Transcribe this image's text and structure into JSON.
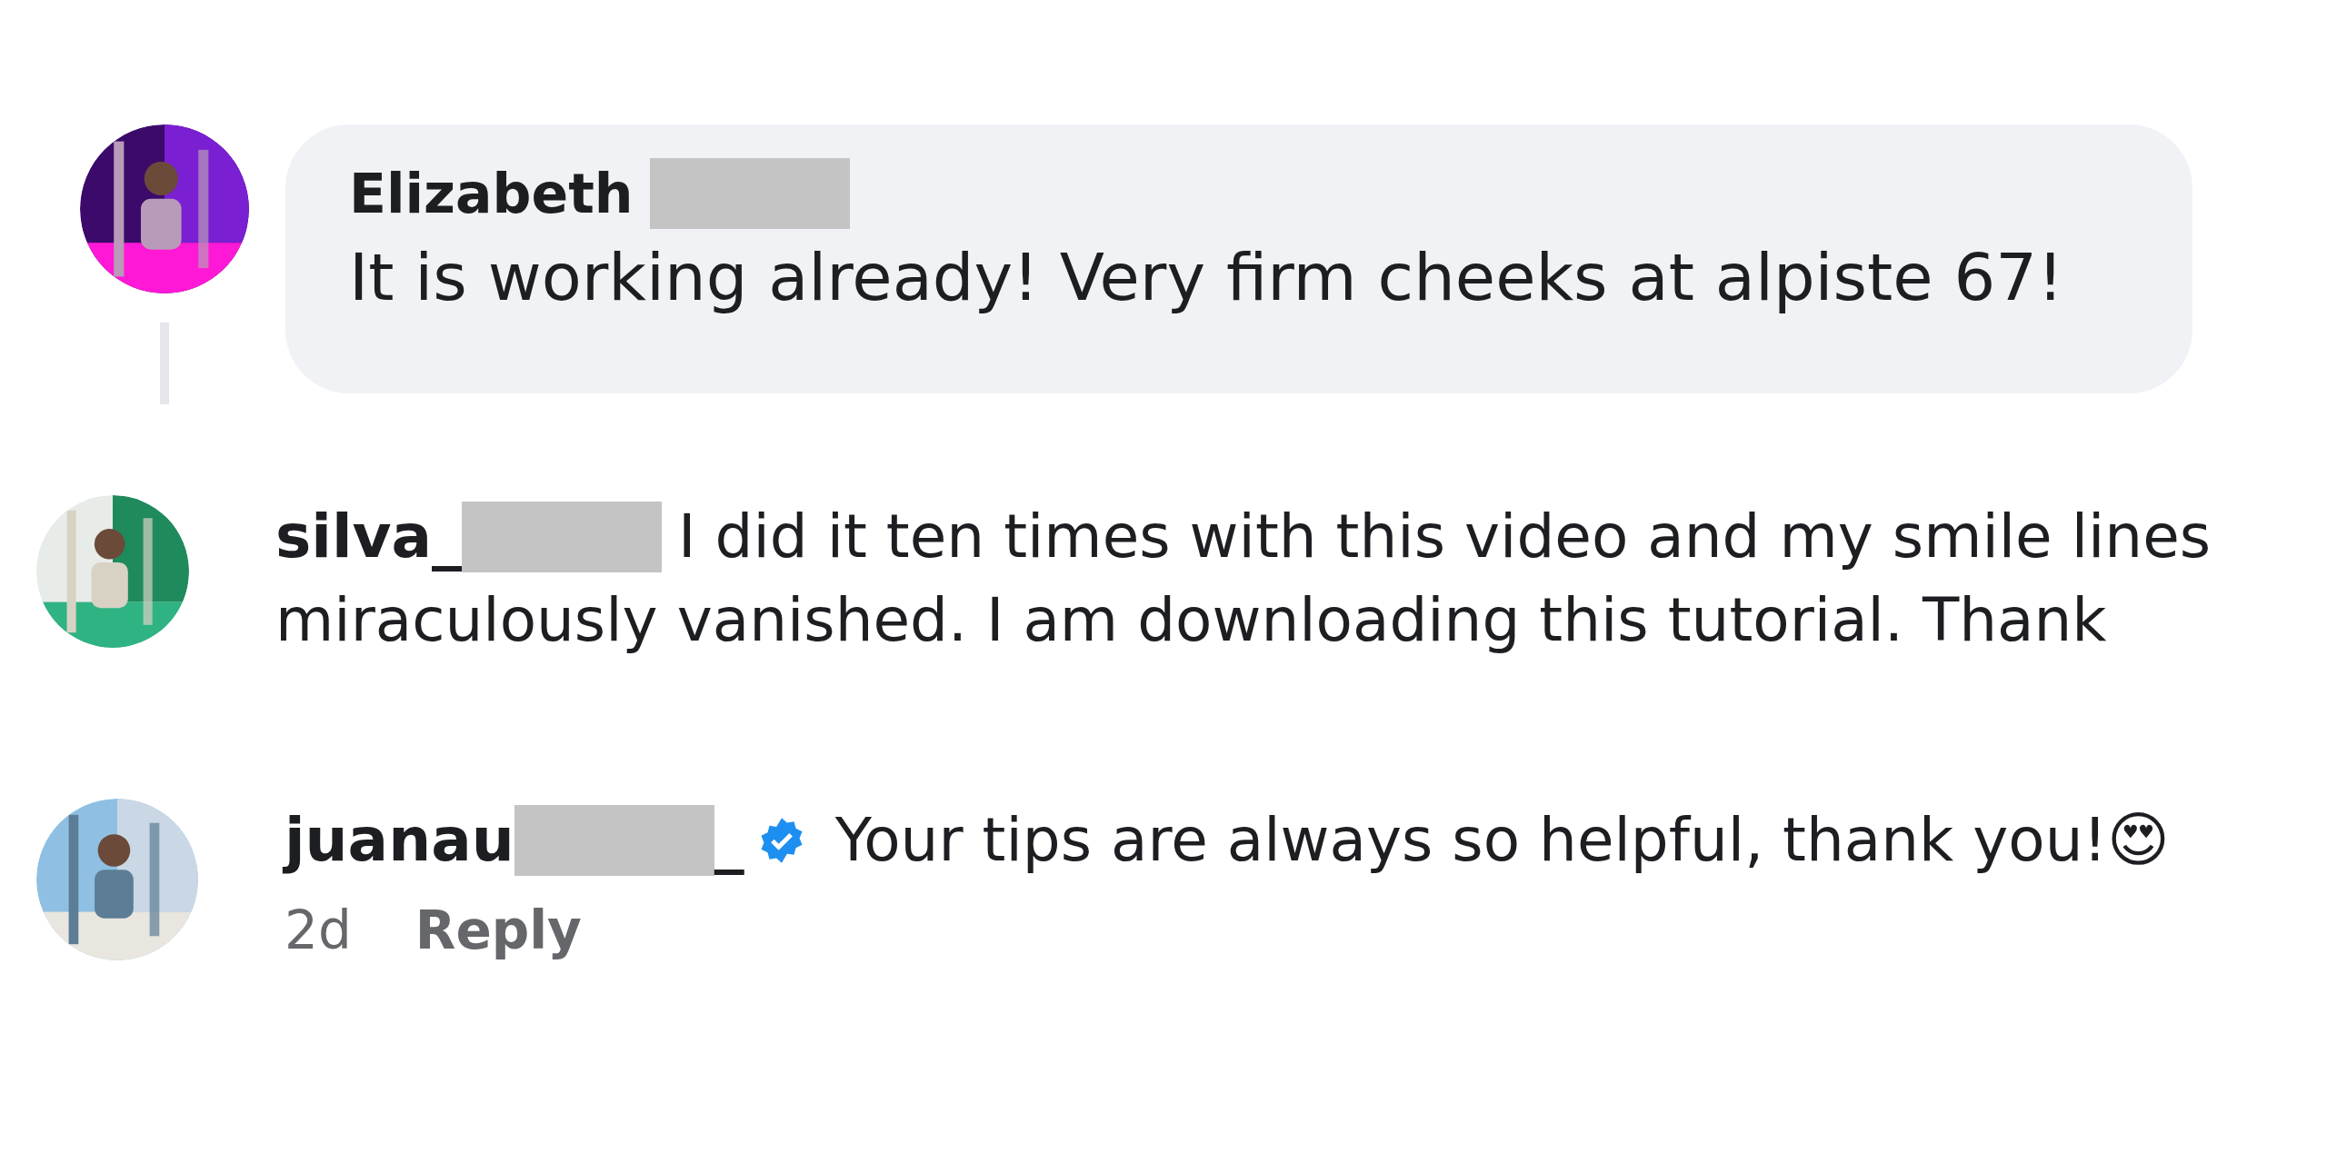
{
  "comments": [
    {
      "kind": "bubble",
      "avatar": {
        "kind": "picture"
      },
      "name_parts": [
        {
          "kind": "text",
          "text": "Elizabeth"
        },
        {
          "kind": "redaction"
        }
      ],
      "lines": [
        "It is working already! Very firm cheeks at alpiste 67!"
      ],
      "thread_line": true
    },
    {
      "kind": "inline",
      "avatar": {
        "kind": "picture"
      },
      "name_parts": [
        {
          "kind": "text",
          "text": "silva_"
        },
        {
          "kind": "redaction"
        }
      ],
      "lines": [
        "I did it ten times with this video and my smile lines",
        "miraculously vanished. I am downloading this tutorial. Thank"
      ],
      "thread_line": false
    },
    {
      "kind": "inline",
      "avatar": {
        "kind": "picture"
      },
      "name_parts": [
        {
          "kind": "text",
          "text": "juanau"
        },
        {
          "kind": "redaction"
        },
        {
          "kind": "text",
          "text": "_"
        },
        {
          "kind": "verified"
        }
      ],
      "lines": [
        "Your tips are always so helpful, thank you!"
      ],
      "emoji": "😍",
      "thread_line": false,
      "time": "2d",
      "reply": "Reply"
    }
  ]
}
